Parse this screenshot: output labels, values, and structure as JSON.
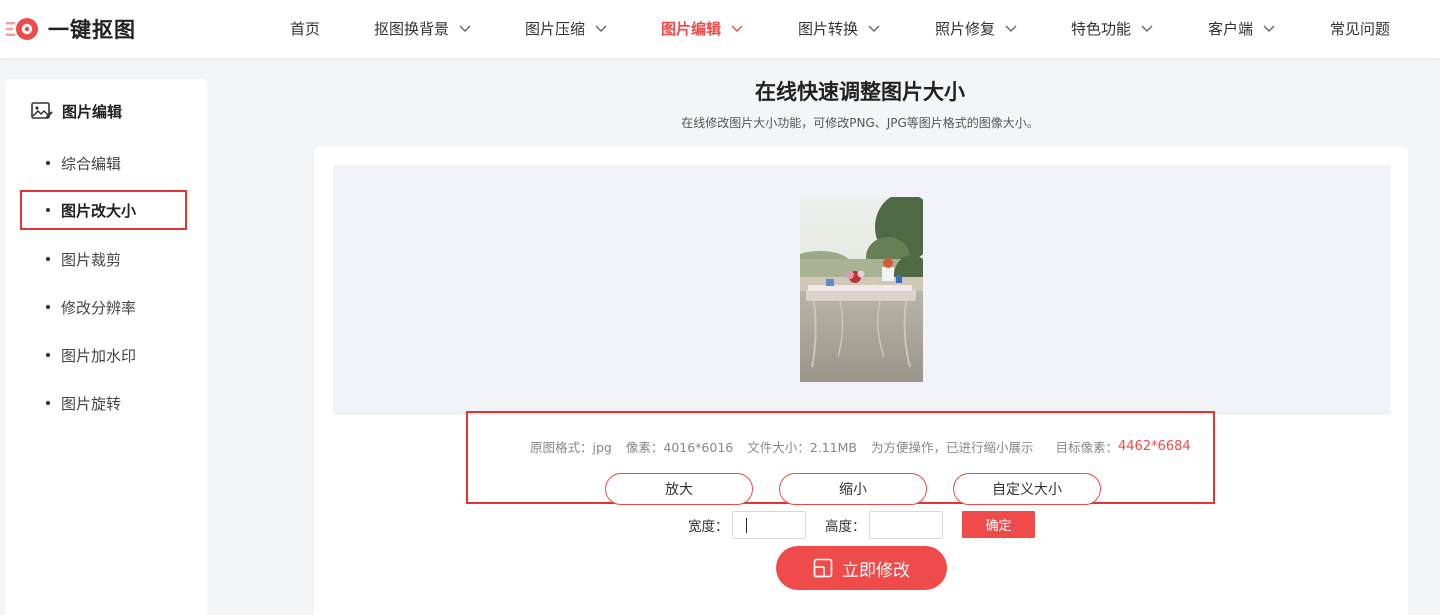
{
  "brand": {
    "name": "一键抠图",
    "color": "#ef4b4b"
  },
  "nav": {
    "items": [
      {
        "label": "首页",
        "has_dropdown": false
      },
      {
        "label": "抠图换背景",
        "has_dropdown": true
      },
      {
        "label": "图片压缩",
        "has_dropdown": true
      },
      {
        "label": "图片编辑",
        "has_dropdown": true,
        "active": true
      },
      {
        "label": "图片转换",
        "has_dropdown": true
      },
      {
        "label": "照片修复",
        "has_dropdown": true
      },
      {
        "label": "特色功能",
        "has_dropdown": true
      },
      {
        "label": "客户端",
        "has_dropdown": true
      },
      {
        "label": "常见问题",
        "has_dropdown": false
      }
    ]
  },
  "sidebar": {
    "title": "图片编辑",
    "icon": "image-edit-icon",
    "items": [
      {
        "label": "综合编辑"
      },
      {
        "label": "图片改大小",
        "active": true
      },
      {
        "label": "图片裁剪"
      },
      {
        "label": "修改分辨率"
      },
      {
        "label": "图片加水印"
      },
      {
        "label": "图片旋转"
      }
    ]
  },
  "main": {
    "title": "在线快速调整图片大小",
    "subtitle": "在线修改图片大小功能，可修改PNG、JPG等图片格式的图像大小。"
  },
  "image_info": {
    "format_label": "原图格式：",
    "format_value": "jpg",
    "pixels_label": "像素：",
    "pixels_value": "4016*6016",
    "size_label": "文件大小：",
    "size_value": "2.11MB",
    "note": "为方便操作，已进行缩小展示",
    "target_label": "目标像素：",
    "target_value": "4462*6684"
  },
  "actions": {
    "enlarge": "放大",
    "shrink": "缩小",
    "custom": "自定义大小",
    "width_label": "宽度：",
    "height_label": "高度：",
    "width_value": "",
    "height_value": "",
    "confirm": "确定",
    "apply": "立即修改"
  }
}
